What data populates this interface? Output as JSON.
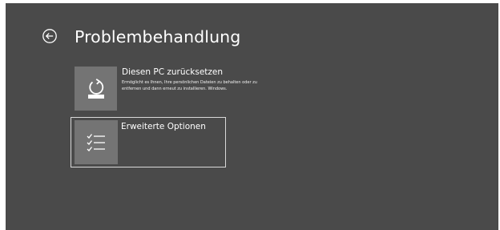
{
  "header": {
    "title": "Problembehandlung",
    "back_icon": "back-arrow-circle-icon"
  },
  "options": [
    {
      "title": "Diesen PC zurücksetzen",
      "description": "Ermöglicht es Ihnen, Ihre persönlichen Dateien zu behalten oder zu entfernen und dann erneut zu installieren. Windows.",
      "icon": "reset-pc-icon",
      "selected": false
    },
    {
      "title": "Erweiterte Optionen",
      "description": "",
      "icon": "checklist-icon",
      "selected": true
    }
  ],
  "colors": {
    "background": "#4a4a4a",
    "tile": "#747474",
    "text": "#ffffff",
    "focus_border": "#d9d9d9"
  }
}
